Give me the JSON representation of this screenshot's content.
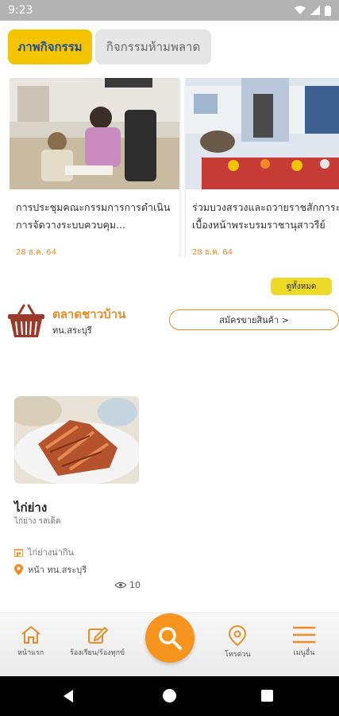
{
  "status_bar": {
    "time": "9:23"
  },
  "tabs": [
    {
      "label": "ภาพกิจกรรม",
      "active": true
    },
    {
      "label": "กิจกรรมห้ามพลาด",
      "active": false
    }
  ],
  "news_cards": [
    {
      "title": "การประชุมคณะกรรมการการดำเนินการจัดวางระบบควบคุม...",
      "date": "28 ธ.ค. 64"
    },
    {
      "title": "ร่วมบวงสรวงและถวายราชสักการะ เบื้องหน้าพระบรมราชานุสาวรีย์",
      "date": "28 ธ.ค. 64"
    }
  ],
  "see_all_label": "ดูทั้งหมด",
  "market": {
    "title": "ตลาดชาวบ้าน",
    "subtitle": "ทน.สระบุรี",
    "register_label": "สมัครขายสินค้า >"
  },
  "product": {
    "name": "ไก่ย่าง",
    "subtitle": "ไก่ย่าง รสเด็ด",
    "shop": "ไก่ย่างน่ากิน",
    "location": "หน้า ทน.สระบุรี",
    "views": "10"
  },
  "bottom_nav": {
    "home": "หน้าแรก",
    "complaint": "ร้องเรียน/ร้องทุกข์",
    "phone": "โทรด่วน",
    "menu": "เมนูอื่น"
  },
  "colors": {
    "accent": "#f7941d",
    "tab_active": "#f5c400",
    "see_all": "#ecd928"
  }
}
